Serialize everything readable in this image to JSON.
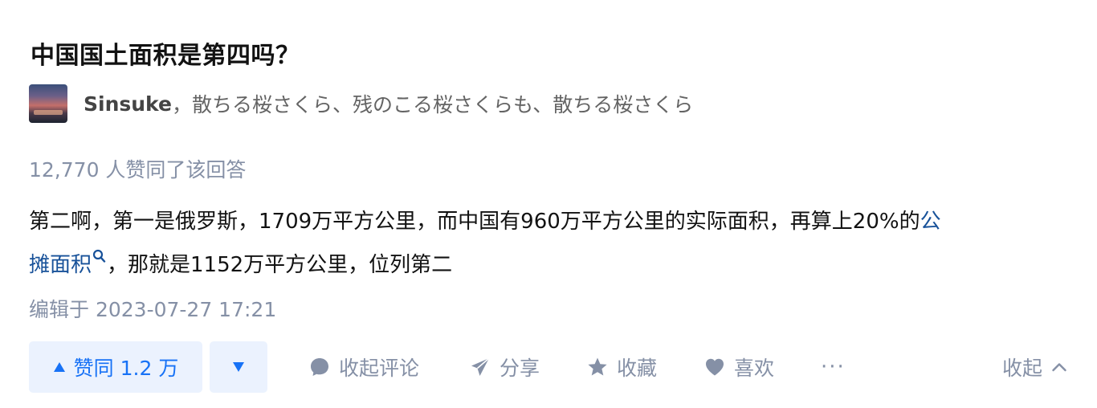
{
  "question": {
    "title": "中国国土面积是第四吗？"
  },
  "author": {
    "name": "Sinsuke",
    "separator": "，",
    "bio": "散ちる桜さくら、残のこる桜さくらも、散ちる桜さくら"
  },
  "stats": {
    "upvote_text": "12,770 人赞同了该回答"
  },
  "answer": {
    "line1_text": "第二啊，第一是俄罗斯，1709万平方公里，而中国有960万平方公里的实际面积，再算上20%的",
    "line1_link": "公",
    "line2_link": "摊面积",
    "line2_text": "，那就是1152万平方公里，位列第二"
  },
  "meta": {
    "edited": "编辑于 2023-07-27 17:21"
  },
  "actions": {
    "upvote_label": "赞同 1.2 万",
    "comment_label": "收起评论",
    "share_label": "分享",
    "collect_label": "收藏",
    "like_label": "喜欢",
    "more_label": "···",
    "collapse_label": "收起"
  },
  "colors": {
    "accent": "#1772f6",
    "accent_bg": "#ebf2fe",
    "muted": "#8590a6",
    "link": "#175199"
  },
  "icons": {
    "avatar": "sunset-cityscape-avatar",
    "upvote": "triangle-up-icon",
    "downvote": "triangle-down-icon",
    "comment": "comment-bubble-icon",
    "share": "paper-plane-icon",
    "collect": "star-icon",
    "like": "heart-icon",
    "collapse": "chevron-up-icon",
    "link_search": "search-icon"
  }
}
